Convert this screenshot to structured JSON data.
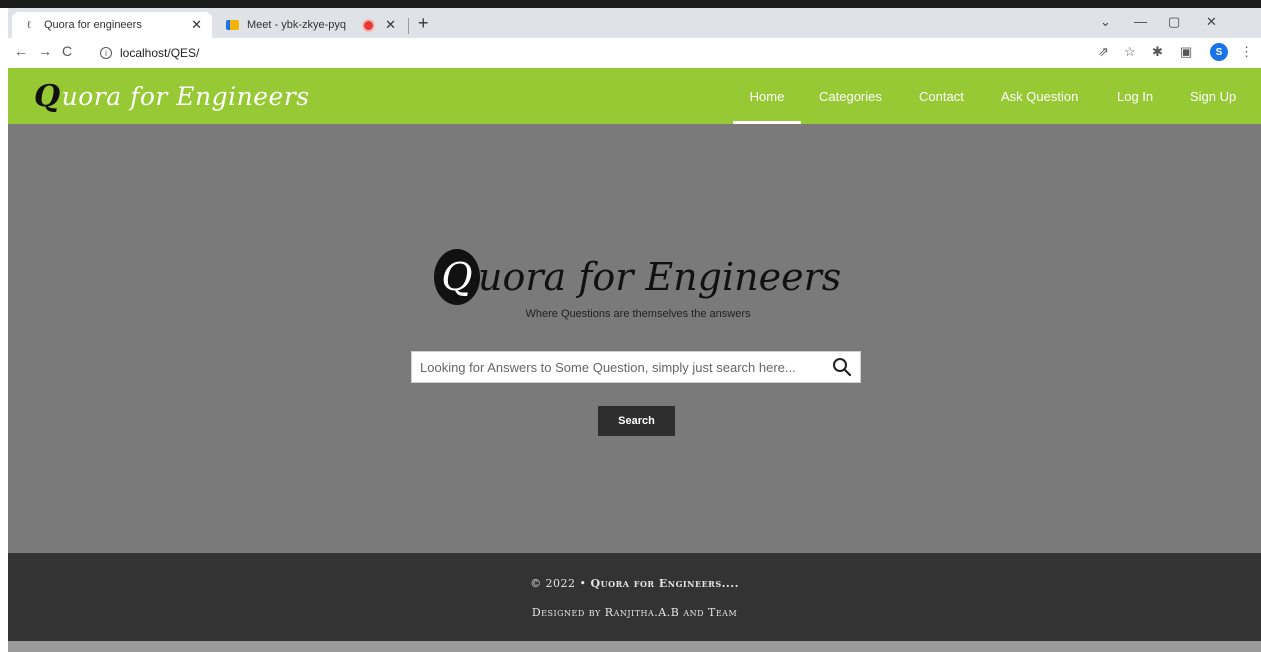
{
  "browser": {
    "tabs": [
      {
        "title": "Quora for engineers",
        "favicon": "quora-favicon",
        "active": true
      },
      {
        "title": "Meet - ybk-zkye-pyq",
        "favicon": "meet-favicon",
        "active": false,
        "recording": true
      }
    ],
    "url": "localhost/QES/",
    "profile_initial": "S"
  },
  "header": {
    "brand_initial": "Q",
    "brand_rest": "uora for Engineers",
    "bg_color": "#97c934",
    "nav": [
      {
        "label": "Home",
        "active": true
      },
      {
        "label": "Categories",
        "active": false
      },
      {
        "label": "Contact",
        "active": false
      },
      {
        "label": "Ask Question",
        "active": false
      },
      {
        "label": "Log In",
        "active": false
      },
      {
        "label": "Sign Up",
        "active": false
      }
    ]
  },
  "hero": {
    "logo_initial": "Q",
    "logo_rest": "uora for Engineers",
    "tagline": "Where Questions are themselves the answers",
    "search_placeholder": "Looking for Answers to Some Question, simply just search here...",
    "search_button": "Search",
    "bg_color": "#7a7a7a"
  },
  "footer": {
    "copyright_prefix": "© 2022 •",
    "copyright_name": "Quora for Engineers....",
    "credit": "Designed by Ranjitha.A.B and Team",
    "bg_color": "#333333"
  }
}
